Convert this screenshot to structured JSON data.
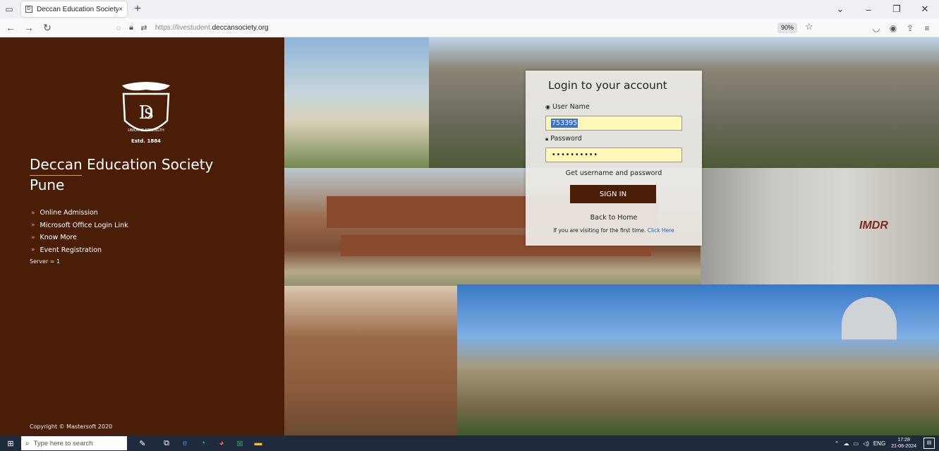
{
  "browser": {
    "tab_title": "Deccan Education Society Pune",
    "tab_close": "×",
    "new_tab": "+",
    "url_prefix": "https://livestudent.",
    "url_domain": "deccansociety.org",
    "zoom": "90%",
    "win_minimize": "–",
    "win_restore": "❐",
    "win_close": "✕"
  },
  "sidebar": {
    "logo_motto": "UNION IS STRENGTH",
    "logo_estd": "Estd. 1884",
    "name": "Deccan Education Society",
    "city": "Pune",
    "links": [
      {
        "label": "Online Admission"
      },
      {
        "label": "Microsoft Office Login Link"
      },
      {
        "label": "Know More"
      },
      {
        "label": "Event Registration"
      }
    ],
    "server": "Server = 1",
    "copyright": "Copyright © Mastersoft 2020"
  },
  "login": {
    "title": "Login to your account",
    "username_label": "User Name",
    "username_value": "753395",
    "password_label": "Password",
    "password_value": "••••••••••",
    "get_credentials": "Get username and password",
    "signin_label": "SIGN IN",
    "back_home": "Back to Home",
    "first_visit_text": "If you are visiting for the first time.",
    "first_visit_link": "Click Here"
  },
  "collage": {
    "imdr_sign": "IMDR"
  },
  "taskbar": {
    "search_placeholder": "Type here to search",
    "language": "ENG",
    "time": "17:28",
    "date": "21-06-2024"
  },
  "colors": {
    "sidebar_bg": "#4a1d07",
    "signin_bg": "#4a1d07",
    "field_bg": "#fff8b8",
    "link_blue": "#1f5fd0"
  }
}
